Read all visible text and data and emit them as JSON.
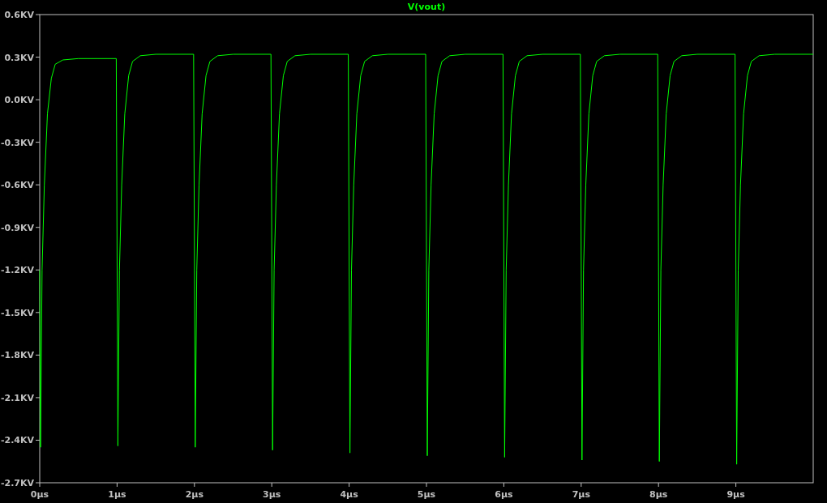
{
  "plot": {
    "chart_data": {
      "type": "line",
      "title": "V(vout)",
      "x": [
        0,
        0.01,
        0.03,
        0.06,
        0.1,
        0.15,
        0.2,
        0.3,
        0.5,
        0.99,
        1.01,
        1.03,
        1.06,
        1.1,
        1.15,
        1.2,
        1.3,
        1.5,
        1.99,
        2.01,
        2.03,
        2.06,
        2.1,
        2.15,
        2.2,
        2.3,
        2.5,
        2.99,
        3.01,
        3.03,
        3.06,
        3.1,
        3.15,
        3.2,
        3.3,
        3.5,
        3.99,
        4.01,
        4.03,
        4.06,
        4.1,
        4.15,
        4.2,
        4.3,
        4.5,
        4.99,
        5.01,
        5.03,
        5.06,
        5.1,
        5.15,
        5.2,
        5.3,
        5.5,
        5.99,
        6.01,
        6.03,
        6.06,
        6.1,
        6.15,
        6.2,
        6.3,
        6.5,
        6.99,
        7.01,
        7.03,
        7.06,
        7.1,
        7.15,
        7.2,
        7.3,
        7.5,
        7.99,
        8.01,
        8.03,
        8.06,
        8.1,
        8.15,
        8.2,
        8.3,
        8.5,
        8.99,
        9.01,
        9.03,
        9.06,
        9.1,
        9.15,
        9.2,
        9.3,
        9.5,
        9.99,
        10
      ],
      "series": [
        {
          "color": "#00ff00",
          "values": [
            -1.2,
            -2.45,
            -1.2,
            -0.6,
            -0.1,
            0.15,
            0.25,
            0.28,
            0.29,
            0.29,
            -2.44,
            -1.2,
            -0.6,
            -0.1,
            0.17,
            0.27,
            0.31,
            0.32,
            0.32,
            -2.45,
            -1.2,
            -0.6,
            -0.1,
            0.17,
            0.27,
            0.31,
            0.32,
            0.32,
            -2.47,
            -1.2,
            -0.6,
            -0.1,
            0.17,
            0.27,
            0.31,
            0.32,
            0.32,
            -2.49,
            -1.2,
            -0.6,
            -0.1,
            0.17,
            0.27,
            0.31,
            0.32,
            0.32,
            -2.51,
            -1.2,
            -0.6,
            -0.1,
            0.17,
            0.27,
            0.31,
            0.32,
            0.32,
            -2.52,
            -1.2,
            -0.6,
            -0.1,
            0.17,
            0.27,
            0.31,
            0.32,
            0.32,
            -2.54,
            -1.2,
            -0.6,
            -0.1,
            0.17,
            0.27,
            0.31,
            0.32,
            0.32,
            -2.55,
            -1.2,
            -0.6,
            -0.1,
            0.17,
            0.27,
            0.31,
            0.32,
            0.32,
            -2.57,
            -1.2,
            -0.6,
            -0.1,
            0.17,
            0.27,
            0.31,
            0.32,
            0.32,
            0.32
          ]
        }
      ],
      "xlim": [
        0,
        10
      ],
      "ylim": [
        -2.7,
        0.6
      ],
      "xticks": [
        {
          "value": 0,
          "label": "0µs"
        },
        {
          "value": 1,
          "label": "1µs"
        },
        {
          "value": 2,
          "label": "2µs"
        },
        {
          "value": 3,
          "label": "3µs"
        },
        {
          "value": 4,
          "label": "4µs"
        },
        {
          "value": 5,
          "label": "5µs"
        },
        {
          "value": 6,
          "label": "6µs"
        },
        {
          "value": 7,
          "label": "7µs"
        },
        {
          "value": 8,
          "label": "8µs"
        },
        {
          "value": 9,
          "label": "9µs"
        }
      ],
      "yticks": [
        {
          "value": 0.6,
          "label": "0.6KV"
        },
        {
          "value": 0.3,
          "label": "0.3KV"
        },
        {
          "value": 0,
          "label": "0.0KV"
        },
        {
          "value": -0.3,
          "label": "-0.3KV"
        },
        {
          "value": -0.6,
          "label": "-0.6KV"
        },
        {
          "value": -0.9,
          "label": "-0.9KV"
        },
        {
          "value": -1.2,
          "label": "-1.2KV"
        },
        {
          "value": -1.5,
          "label": "-1.5KV"
        },
        {
          "value": -1.8,
          "label": "-1.8KV"
        },
        {
          "value": -2.1,
          "label": "-2.1KV"
        },
        {
          "value": -2.4,
          "label": "-2.4KV"
        },
        {
          "value": -2.7,
          "label": "-2.7KV"
        }
      ]
    }
  }
}
